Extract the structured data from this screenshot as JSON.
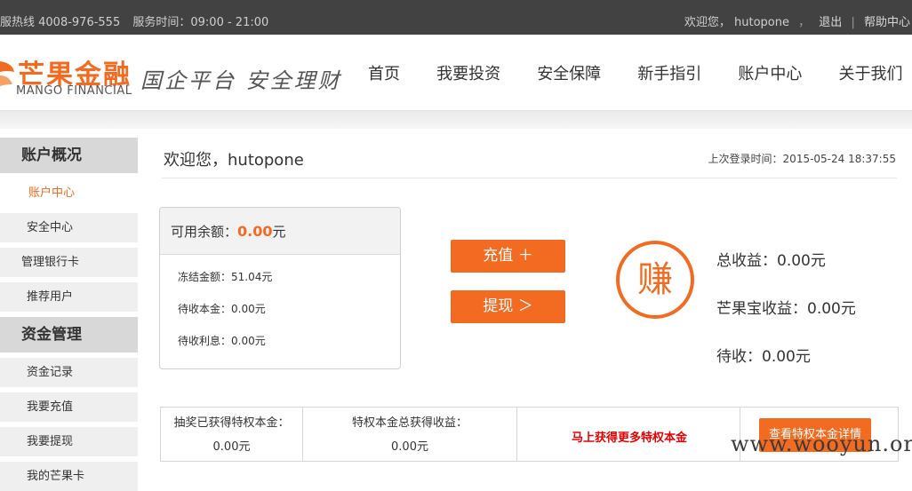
{
  "topbar": {
    "hotline": "服热线 4008-976-555",
    "service_time": "服务时间：09:00 - 21:00",
    "welcome": "欢迎您， hutopone",
    "logout": "退出",
    "help": "帮助中心"
  },
  "logo": {
    "cn": "芒果金融",
    "en": "MANGO FINANCIAL"
  },
  "slogan": "国企平台 安全理财",
  "nav": [
    "首页",
    "我要投资",
    "安全保障",
    "新手指引",
    "账户中心",
    "关于我们"
  ],
  "sidebar": {
    "account_heading": "账户概况",
    "account_items": [
      "账户中心",
      "安全中心",
      "管理银行卡",
      "推荐用户"
    ],
    "funds_heading": "资金管理",
    "funds_items": [
      "资金记录",
      "我要充值",
      "我要提现",
      "我的芒果卡"
    ]
  },
  "main": {
    "welcome": "欢迎您，hutopone",
    "last_login": "上次登录时间：2015-05-24 18:37:55",
    "balance_label": "可用余额：",
    "balance_value": "0.00",
    "balance_unit": "元",
    "frozen": "冻结金额：51.04元",
    "pending_principal": "待收本金：0.00元",
    "pending_interest": "待收利息：0.00元",
    "recharge_button": "充值 ＋",
    "withdraw_button": "提现 ＞",
    "earn_glyph": "赚",
    "total_income": "总收益：0.00元",
    "mango_income": "芒果宝收益：0.00元",
    "pending": "待收：0.00元"
  },
  "privilege": {
    "col1_title": "抽奖已获得特权本金：",
    "col1_value": "0.00元",
    "col2_title": "特权本金总获得收益：",
    "col2_value": "0.00元",
    "more_link": "马上获得更多特权本金",
    "detail_button": "查看特权本金详情"
  },
  "watermark": "www.wooyun.org",
  "colors": {
    "accent": "#f26b21",
    "topbar": "#424242",
    "alert_red": "#e60000"
  }
}
